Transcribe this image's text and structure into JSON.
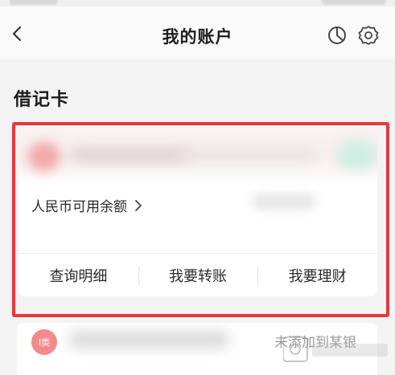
{
  "header": {
    "title": "我的账户",
    "back_icon": "chevron-left-icon",
    "chart_icon": "pie-chart-icon",
    "settings_icon": "gear-icon"
  },
  "debit_section": {
    "title": "借记卡"
  },
  "primary_card": {
    "balance_label": "人民币可用余额",
    "actions": [
      "查询明细",
      "我要转账",
      "我要理财"
    ]
  },
  "secondary_card": {
    "badge": "I类",
    "status": "未添加到某银"
  },
  "colors": {
    "highlight": "#e5393a",
    "badge_bg": "#f28b8b",
    "page_bg": "#f3f3f3"
  }
}
